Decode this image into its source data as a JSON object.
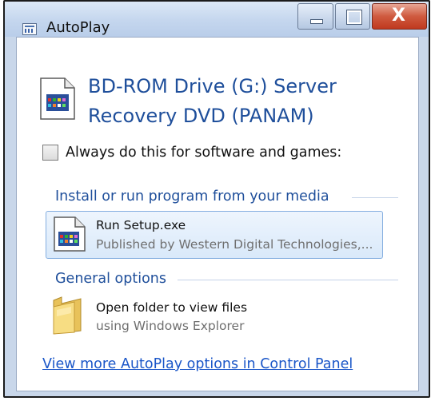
{
  "window": {
    "title": "AutoPlay",
    "close_glyph": "X"
  },
  "device": {
    "heading_line1": "BD-ROM Drive (G:) Server",
    "heading_line2": "Recovery DVD (PANAM)"
  },
  "always_option": {
    "label": "Always do this for software and games:",
    "checked": false
  },
  "install_section": {
    "label": "Install or run program from your media",
    "item_title": "Run Setup.exe",
    "item_subtitle": "Published by Western Digital Technologies,..."
  },
  "general_section": {
    "label": "General options",
    "item_title": "Open folder to view files",
    "item_subtitle": "using Windows Explorer"
  },
  "footer": {
    "link_text": "View more AutoPlay options in Control Panel"
  },
  "icons": {
    "window_icon": "autoplay-window-icon",
    "device_icon": "setup-document-icon",
    "run_icon": "setup-document-icon",
    "folder_icon": "folder-icon"
  },
  "colors": {
    "heading": "#1f4f9b",
    "link": "#1a56c8",
    "close_button": "#c0391f",
    "selection": "#d9e9fa"
  }
}
